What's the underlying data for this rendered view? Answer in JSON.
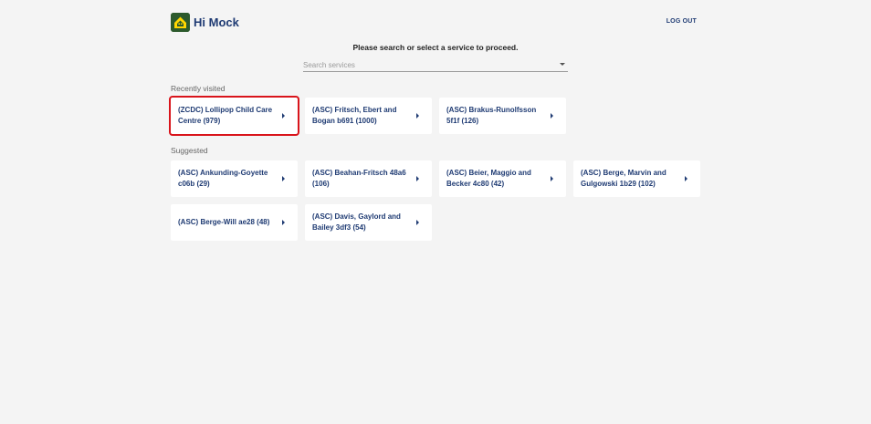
{
  "header": {
    "greeting": "Hi Mock",
    "logout_label": "LOG OUT"
  },
  "prompt": "Please search or select a service to proceed.",
  "search": {
    "placeholder": "Search services",
    "value": ""
  },
  "recent": {
    "label": "Recently visited",
    "items": [
      {
        "name": "(ZCDC) Lollipop Child Care Centre (979)"
      },
      {
        "name": "(ASC) Fritsch, Ebert and Bogan b691 (1000)"
      },
      {
        "name": "(ASC) Brakus-Runolfsson 5f1f (126)"
      }
    ]
  },
  "suggested": {
    "label": "Suggested",
    "items": [
      {
        "name": "(ASC) Ankunding-Goyette c06b (29)"
      },
      {
        "name": "(ASC) Beahan-Fritsch 48a6 (106)"
      },
      {
        "name": "(ASC) Beier, Maggio and Becker 4c80 (42)"
      },
      {
        "name": "(ASC) Berge, Marvin and Gulgowski 1b29 (102)"
      },
      {
        "name": "(ASC) Berge-Will ae28 (48)"
      },
      {
        "name": "(ASC) Davis, Gaylord and Bailey 3df3 (54)"
      }
    ]
  },
  "colors": {
    "accent": "#1f3b73",
    "highlight": "#d9141b",
    "logo": "#2c5a2c"
  }
}
